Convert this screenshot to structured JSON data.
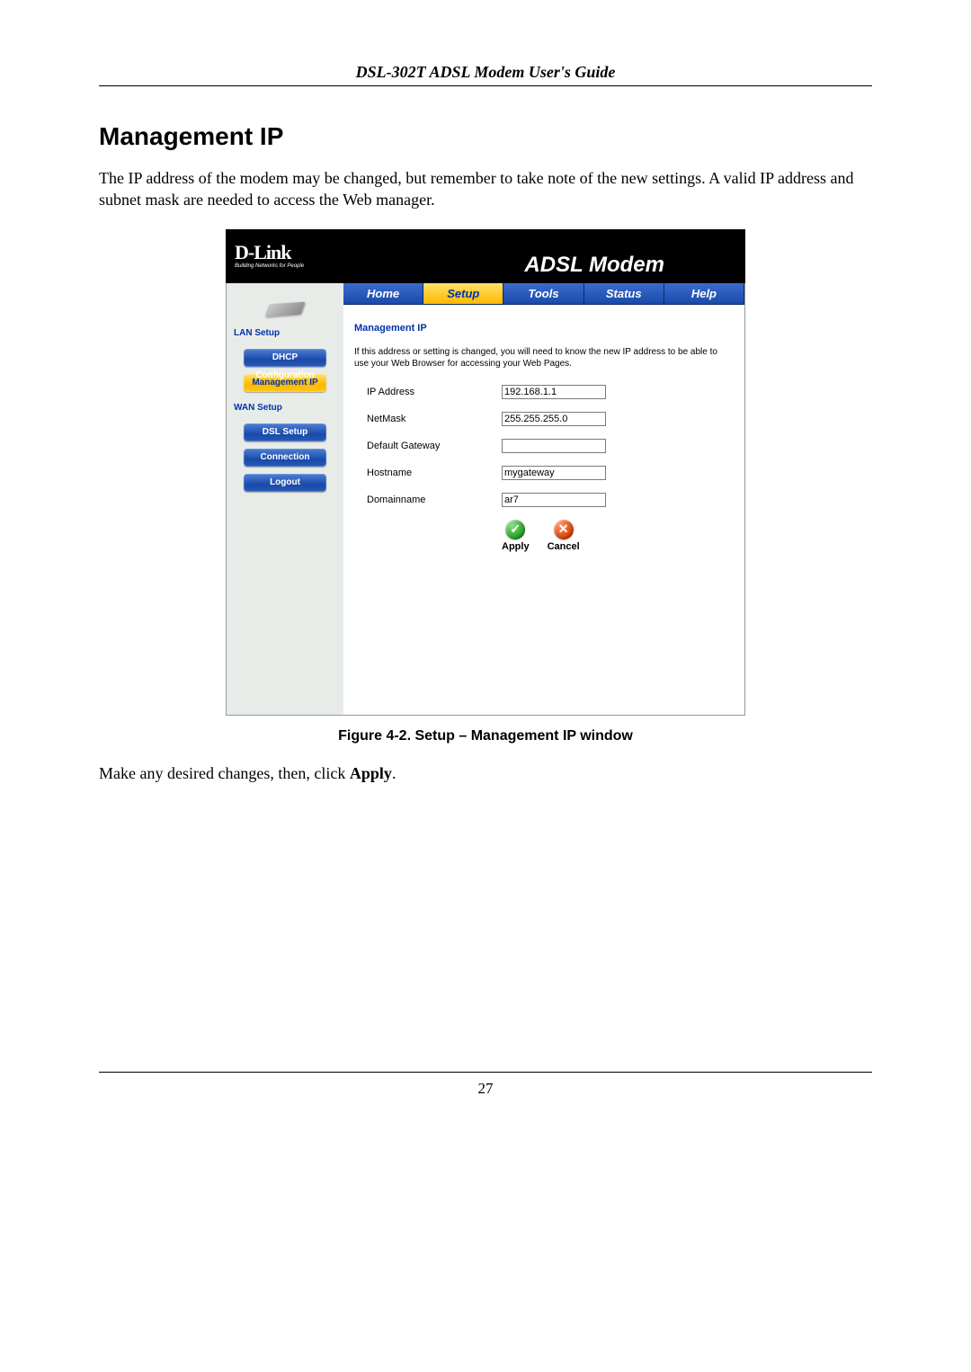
{
  "doc": {
    "header": "DSL-302T ADSL Modem User's Guide",
    "section_title": "Management IP",
    "intro": "The IP address of the modem may be changed, but remember to take note of the new settings. A valid IP address and subnet mask are needed to access the Web manager.",
    "figure_caption": "Figure 4-2. Setup – Management IP window",
    "outro_prefix": "Make any desired changes, then, click ",
    "outro_bold": "Apply",
    "outro_suffix": ".",
    "page_number": "27"
  },
  "modem": {
    "brand": "D-Link",
    "brand_sub": "Building Networks for People",
    "banner_title": "ADSL Modem",
    "tabs": [
      "Home",
      "Setup",
      "Tools",
      "Status",
      "Help"
    ],
    "active_tab": 1,
    "sidebar": {
      "section1": "LAN Setup",
      "section2": "WAN Setup",
      "buttons": {
        "dhcp": "DHCP Configuration",
        "mgmt": "Management IP",
        "dsl": "DSL Setup",
        "conn": "Connection",
        "logout": "Logout"
      }
    },
    "panel": {
      "title": "Management IP",
      "desc": "If this address or setting is changed, you will need to know the new IP address to be able to use your Web Browser for accessing your Web Pages.",
      "fields": {
        "ip_label": "IP Address",
        "ip_value": "192.168.1.1",
        "netmask_label": "NetMask",
        "netmask_value": "255.255.255.0",
        "gateway_label": "Default Gateway",
        "gateway_value": "",
        "hostname_label": "Hostname",
        "hostname_value": "mygateway",
        "domain_label": "Domainname",
        "domain_value": "ar7"
      },
      "apply": "Apply",
      "cancel": "Cancel"
    }
  }
}
